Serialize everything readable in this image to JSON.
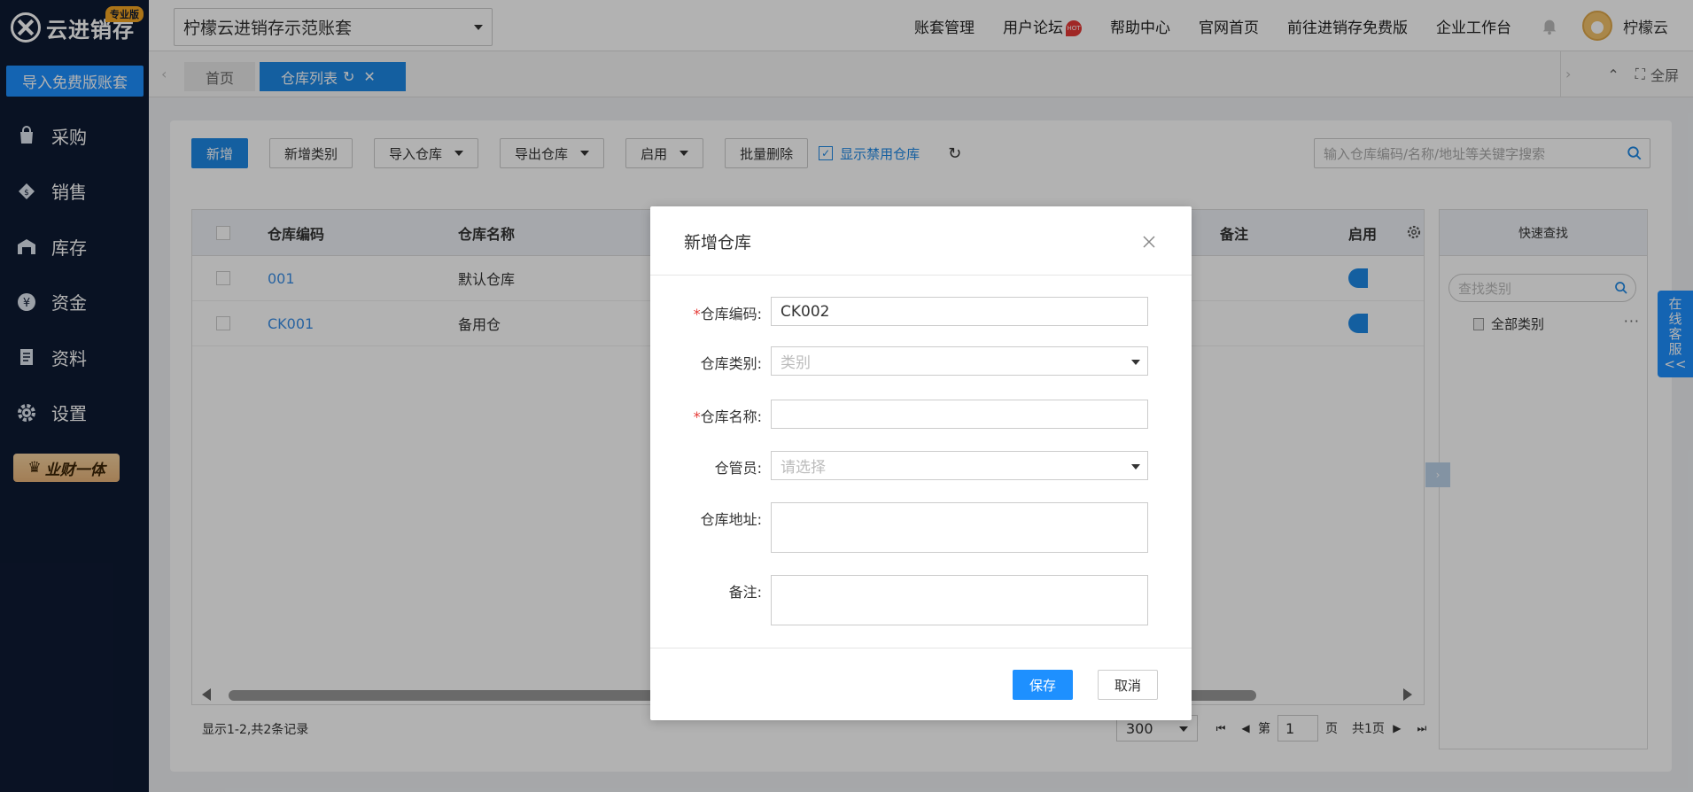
{
  "sidebar": {
    "logo": "云进销存",
    "badge": "专业版",
    "import_label": "导入免费版账套",
    "items": [
      {
        "label": "采购",
        "icon": "bag-icon"
      },
      {
        "label": "销售",
        "icon": "sale-tag-icon"
      },
      {
        "label": "库存",
        "icon": "warehouse-icon"
      },
      {
        "label": "资金",
        "icon": "yen-coin-icon"
      },
      {
        "label": "资料",
        "icon": "document-icon"
      },
      {
        "label": "设置",
        "icon": "gear-icon"
      }
    ],
    "vip_label": "业财一体"
  },
  "topbar": {
    "account": "柠檬云进销存示范账套",
    "links": [
      "账套管理",
      "用户论坛",
      "帮助中心",
      "官网首页",
      "前往进销存免费版",
      "企业工作台"
    ],
    "hot": "HOT",
    "user": "柠檬云"
  },
  "tabs": {
    "home": "首页",
    "active": "仓库列表",
    "fullscreen": "全屏"
  },
  "toolbar": {
    "add": "新增",
    "add_category": "新增类别",
    "import": "导入仓库",
    "export": "导出仓库",
    "enable": "启用",
    "batch_delete": "批量删除",
    "show_disabled": "显示禁用仓库",
    "search_placeholder": "输入仓库编码/名称/地址等关键字搜索"
  },
  "grid": {
    "columns": {
      "code": "仓库编码",
      "name": "仓库名称",
      "remark": "备注",
      "enable": "启用"
    },
    "rows": [
      {
        "code": "001",
        "name": "默认仓库"
      },
      {
        "code": "CK001",
        "name": "备用仓"
      }
    ],
    "record_info": "显示1-2,共2条记录",
    "page_size": "300",
    "page_prefix": "第",
    "page": "1",
    "page_suffix": "页",
    "total_pages": "共1页"
  },
  "quick": {
    "title": "快速查找",
    "search_placeholder": "查找类别",
    "item": "全部类别"
  },
  "service": [
    "在",
    "线",
    "客",
    "服",
    "<<"
  ],
  "modal": {
    "title": "新增仓库",
    "fields": {
      "code_label": "仓库编码:",
      "code_value": "CK002",
      "category_label": "仓库类别:",
      "category_placeholder": "类别",
      "name_label": "仓库名称:",
      "keeper_label": "仓管员:",
      "keeper_placeholder": "请选择",
      "address_label": "仓库地址:",
      "remark_label": "备注:"
    },
    "save": "保存",
    "cancel": "取消"
  },
  "colors": {
    "primary": "#1e88e5",
    "sidebar": "#0e1a33",
    "required": "#e53935"
  }
}
